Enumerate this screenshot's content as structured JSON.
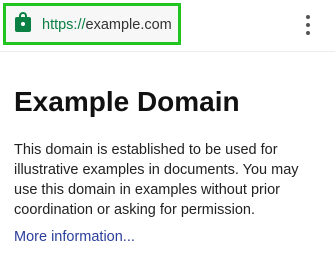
{
  "browser": {
    "url_scheme": "https://",
    "url_host": "example.com",
    "icons": {
      "secure": "lock-icon",
      "menu": "more-vert-icon"
    },
    "colors": {
      "url_highlight": "#22c41f",
      "secure": "#0b8043"
    }
  },
  "page": {
    "title": "Example Domain",
    "paragraph_lines": [
      "This domain is established to be used for",
      "illustrative examples in documents. You may",
      "use this domain in examples without prior",
      "coordination or asking for permission."
    ],
    "link_text": "More information...",
    "link_color": "#2c3e9c"
  }
}
